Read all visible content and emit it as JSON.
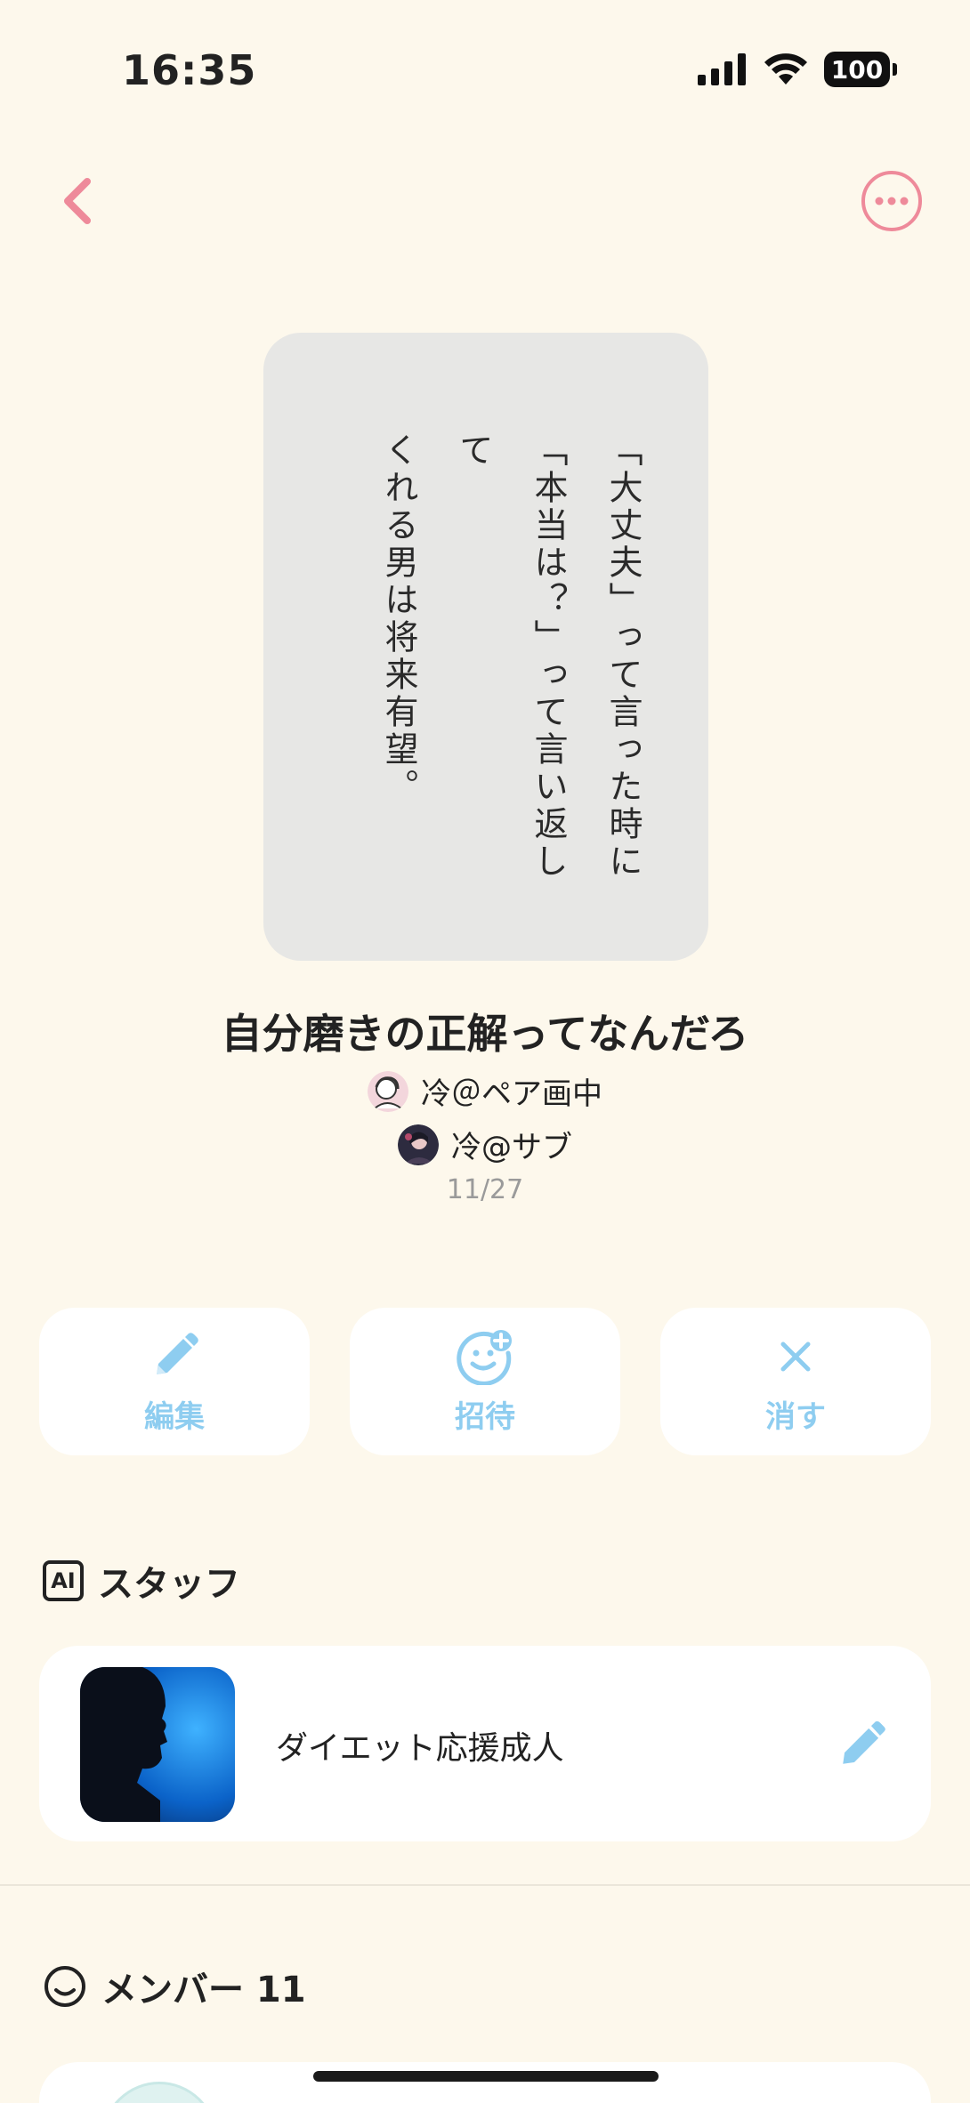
{
  "status_bar": {
    "time": "16:35",
    "battery": "100"
  },
  "card": {
    "lines": [
      "「大丈夫」って言った時に",
      "「本当は？」って言い返して",
      "くれる男は将来有望。"
    ]
  },
  "post": {
    "title": "自分磨きの正解ってなんだろ",
    "authors": [
      "冷＠ペア画中",
      "冷@サブ"
    ],
    "date": "11/27"
  },
  "actions": {
    "edit": "編集",
    "invite": "招待",
    "delete": "消す"
  },
  "staff": {
    "badge": "AI",
    "heading": "スタッフ",
    "name": "ダイエット応援成人"
  },
  "members": {
    "heading": "メンバー 11"
  },
  "colors": {
    "accent_pink": "#ee8a9a",
    "accent_blue": "#8ecdf0",
    "background": "#fdf8ec"
  }
}
